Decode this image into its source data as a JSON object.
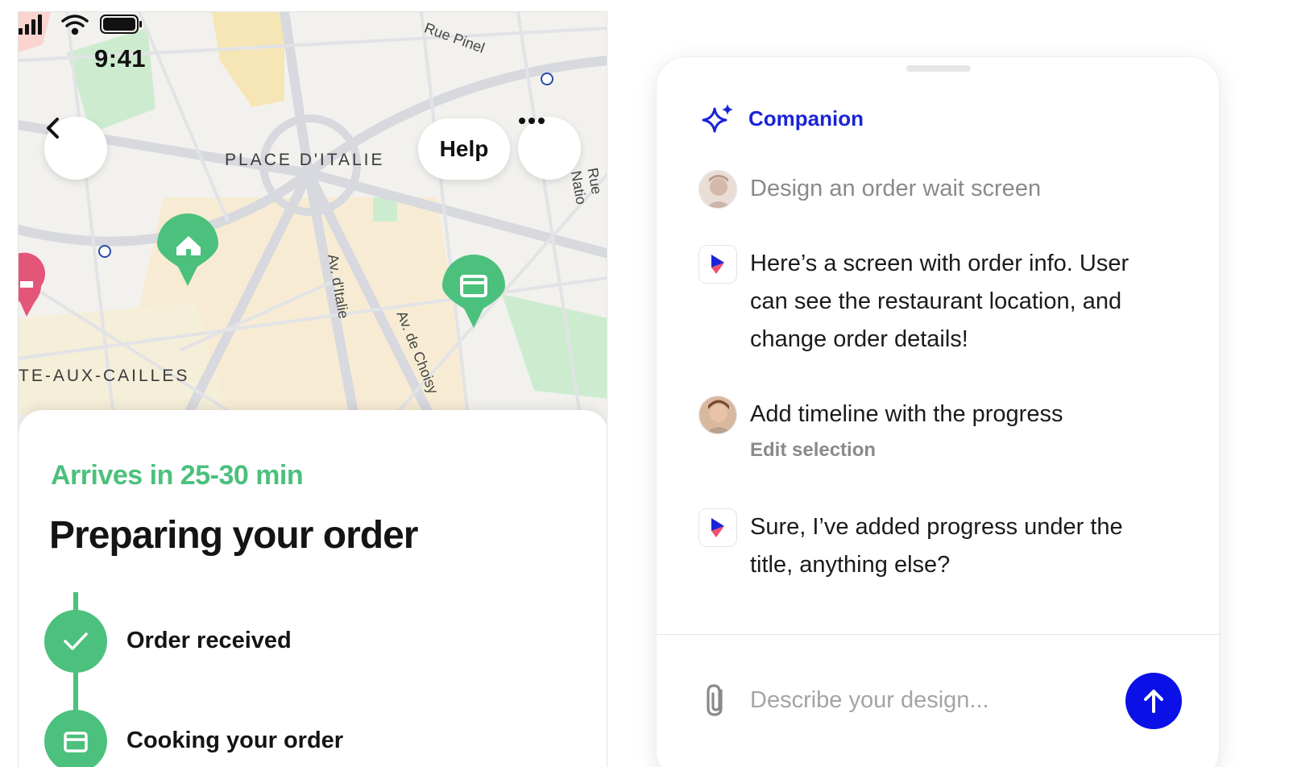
{
  "phone": {
    "status_time": "9:41",
    "map": {
      "district_label": "PLACE D'ITALIE",
      "district_label_2": "TE-AUX-CAILLES",
      "streets": [
        "Rue Pinel",
        "Av. d'Italie",
        "Av. de Choisy",
        "Rue Natio"
      ]
    },
    "help_label": "Help",
    "sheet": {
      "eta": "Arrives in 25-30 min",
      "title": "Preparing your order",
      "steps": [
        {
          "label": "Order received"
        },
        {
          "label": "Cooking your order"
        }
      ]
    },
    "colors": {
      "accent_green": "#4cc07d"
    }
  },
  "companion": {
    "title": "Companion",
    "messages": [
      {
        "role": "user",
        "text": "Design an order wait screen"
      },
      {
        "role": "assistant",
        "text": "Here’s a screen with order info. User can see the restaurant location, and change order details!"
      },
      {
        "role": "user",
        "text": "Add timeline with the progress",
        "sub": "Edit selection"
      },
      {
        "role": "assistant",
        "text": "Sure, I’ve added progress under the title, anything else?"
      }
    ],
    "input_placeholder": "Describe your design...",
    "colors": {
      "brand_blue": "#1a24d6",
      "send_blue": "#0a10e6"
    }
  }
}
